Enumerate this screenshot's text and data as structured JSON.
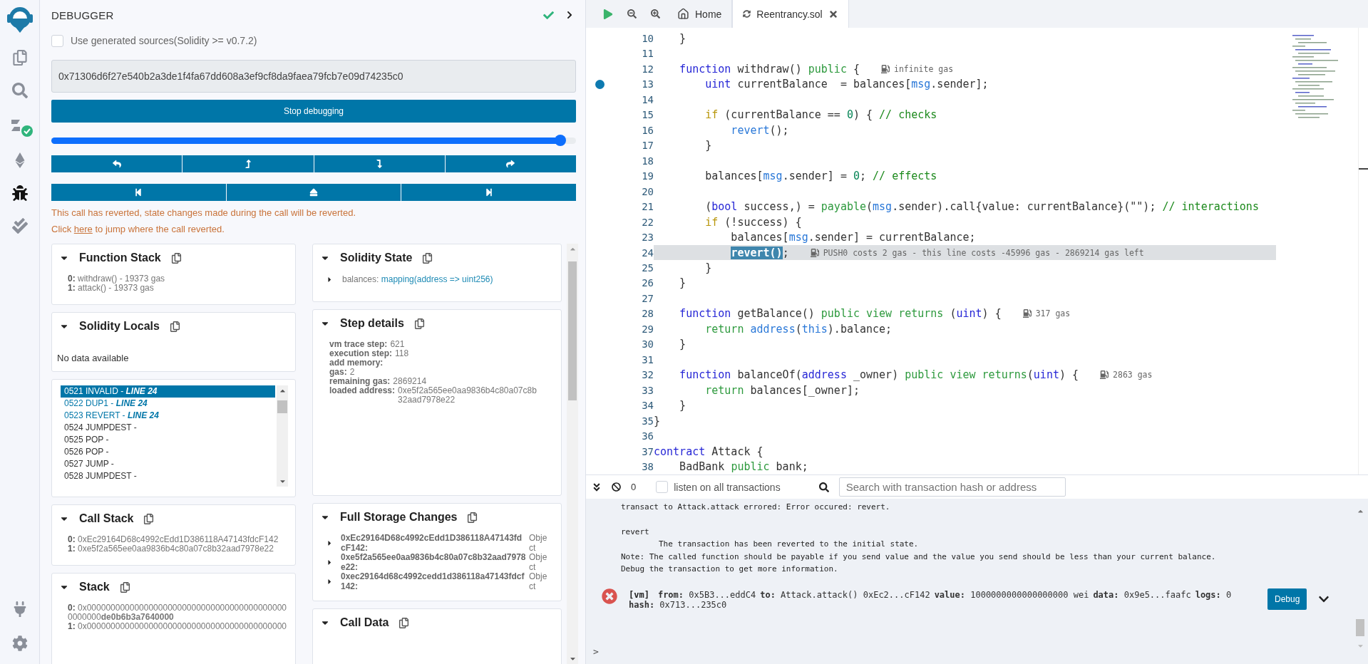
{
  "sidebar": {
    "items": [
      {
        "kind": "files",
        "selected": false
      },
      {
        "kind": "search",
        "selected": false
      },
      {
        "kind": "compiler",
        "selected": false
      },
      {
        "kind": "deploy",
        "selected": false
      },
      {
        "kind": "debugger",
        "selected": true
      },
      {
        "kind": "tests",
        "selected": false
      }
    ],
    "bottom": [
      {
        "kind": "plugins",
        "selected": false
      },
      {
        "kind": "settings",
        "selected": false
      }
    ]
  },
  "debugger": {
    "title": "DEBUGGER",
    "generated_sources": {
      "label": "Use generated sources(Solidity >= v0.7.2)",
      "checked": false
    },
    "tx_hash": "0x71306d6f27e540b2a3de1f4fa67dd608a3ef9cf8da9faea79fcb7e09d74235c0",
    "stop_button": "Stop debugging",
    "slider": {
      "level": 0.97
    },
    "error": {
      "message": "This call has reverted, state changes made during the call will be reverted.",
      "before": "Click",
      "link": "here",
      "after": "to jump where the call reverted."
    },
    "left_panels": [
      {
        "kind": "list",
        "title": "Function Stack",
        "expanded": true,
        "items": [
          {
            "index": "0:",
            "value": "withdraw() - 19373 gas"
          },
          {
            "index": "1:",
            "value": "attack() - 19373 gas"
          }
        ]
      },
      {
        "kind": "empty",
        "title": "Solidity Locals",
        "expanded": true,
        "message": "No data available"
      },
      {
        "kind": "opcodes",
        "items": [
          {
            "code": "0521 INVALID -",
            "line": "LINE 24",
            "selected": true
          },
          {
            "code": "0522 DUP1 -",
            "line": "LINE 24",
            "selected": false
          },
          {
            "code": "0523 REVERT -",
            "line": "LINE 24",
            "selected": false
          },
          {
            "code": "0524 JUMPDEST -",
            "selected": false
          },
          {
            "code": "0525 POP -",
            "selected": false
          },
          {
            "code": "0526 POP -",
            "selected": false
          },
          {
            "code": "0527 JUMP -",
            "selected": false
          },
          {
            "code": "0528 JUMPDEST -",
            "selected": false
          }
        ]
      },
      {
        "kind": "list",
        "title": "Call Stack",
        "expanded": true,
        "items": [
          {
            "index": "0:",
            "value": "0xEc29164D68c4992cEdd1D386118A47143fdcF142"
          },
          {
            "index": "1:",
            "value": "0xe5f2a565ee0aa9836b4c80a07c8b32aad7978e22"
          }
        ]
      },
      {
        "kind": "words",
        "title": "Stack",
        "expanded": true,
        "items": [
          {
            "index": "0:",
            "value": "0x0000000000000000000000000000000000000000000000000**de0b6b3a7640000**"
          },
          {
            "index": "1:",
            "value": "0x000000000000000000000000000000000000000000"
          }
        ]
      }
    ],
    "right_panels": [
      {
        "kind": "tree",
        "title": "Solidity State",
        "expanded": true,
        "items": [
          {
            "name": "balances:",
            "value": "mapping(address => uint256)",
            "expanded": false
          }
        ]
      },
      {
        "kind": "details",
        "title": "Step details",
        "expanded": true,
        "items": [
          {
            "label": "vm trace step:",
            "value": "621"
          },
          {
            "label": "execution step:",
            "value": "118"
          },
          {
            "label": "add memory:"
          },
          {
            "label": "gas:",
            "value": "2"
          },
          {
            "label": "remaining gas:",
            "value": "2869214"
          },
          {
            "label": "loaded address:",
            "value": "0xe5f2a565ee0aa9836b4c80a07c8b32aad7978e22"
          }
        ]
      },
      {
        "kind": "storage",
        "title": "Full Storage Changes",
        "expanded": true,
        "items": [
          {
            "name": "0xEc29164D68c4992cEdd1D386118A47143fdcF142:",
            "value": "Object",
            "expanded": false
          },
          {
            "name": "0xe5f2a565ee0aa9836b4c80a07c8b32aad7978e22:",
            "value": "Object",
            "expanded": false
          },
          {
            "name": "0xec29164d68c4992cedd1d386118a47143fdcf142:",
            "value": "Object",
            "expanded": false
          }
        ]
      },
      {
        "kind": "empty",
        "title": "Call Data",
        "expanded": true
      }
    ]
  },
  "editor": {
    "tabs": [
      {
        "kind": "home",
        "label": "Home",
        "selected": false
      },
      {
        "kind": "file",
        "label": "Reentrancy.sol",
        "selected": true
      }
    ],
    "lines": [
      {
        "number": "10",
        "tokens": [
          {
            "text": "    }",
            "kind": "plain"
          }
        ]
      },
      {
        "number": "11"
      },
      {
        "number": "12",
        "tokens": [
          {
            "text": "    function",
            "kind": "kw"
          },
          {
            "text": " withdraw() ",
            "kind": "plain"
          },
          {
            "text": "public",
            "kind": "mod"
          },
          {
            "text": " {",
            "kind": "plain"
          }
        ],
        "gas": "infinite gas"
      },
      {
        "number": "13",
        "breakpoint": true,
        "tokens": [
          {
            "text": "        uint",
            "kind": "kw"
          },
          {
            "text": " currentBalance  = balances[",
            "kind": "plain"
          },
          {
            "text": "msg",
            "kind": "fn"
          },
          {
            "text": ".sender];",
            "kind": "plain"
          }
        ]
      },
      {
        "number": "14"
      },
      {
        "number": "15",
        "tokens": [
          {
            "text": "        if",
            "kind": "ctl"
          },
          {
            "text": " (currentBalance == ",
            "kind": "plain"
          },
          {
            "text": "0",
            "kind": "num"
          },
          {
            "text": ") { ",
            "kind": "plain"
          },
          {
            "text": "// checks",
            "kind": "cmt"
          }
        ]
      },
      {
        "number": "16",
        "tokens": [
          {
            "text": "            revert",
            "kind": "fn"
          },
          {
            "text": "();",
            "kind": "plain"
          }
        ]
      },
      {
        "number": "17",
        "tokens": [
          {
            "text": "        }",
            "kind": "plain"
          }
        ]
      },
      {
        "number": "18"
      },
      {
        "number": "19",
        "tokens": [
          {
            "text": "        balances[",
            "kind": "plain"
          },
          {
            "text": "msg",
            "kind": "fn"
          },
          {
            "text": ".sender] = ",
            "kind": "plain"
          },
          {
            "text": "0",
            "kind": "num"
          },
          {
            "text": "; ",
            "kind": "plain"
          },
          {
            "text": "// effects",
            "kind": "cmt"
          }
        ]
      },
      {
        "number": "20"
      },
      {
        "number": "21",
        "tokens": [
          {
            "text": "        (",
            "kind": "plain"
          },
          {
            "text": "bool",
            "kind": "kw"
          },
          {
            "text": " success,) = ",
            "kind": "plain"
          },
          {
            "text": "payable",
            "kind": "mod"
          },
          {
            "text": "(",
            "kind": "plain"
          },
          {
            "text": "msg",
            "kind": "fn"
          },
          {
            "text": ".sender).call{value: currentBalance}(\"\"); ",
            "kind": "plain"
          },
          {
            "text": "// interactions",
            "kind": "cmt"
          }
        ]
      },
      {
        "number": "22",
        "tokens": [
          {
            "text": "        if",
            "kind": "ctl"
          },
          {
            "text": " (!success) {",
            "kind": "plain"
          }
        ]
      },
      {
        "number": "23",
        "tokens": [
          {
            "text": "            balances[",
            "kind": "plain"
          },
          {
            "text": "msg",
            "kind": "fn"
          },
          {
            "text": ".sender] = currentBalance;",
            "kind": "plain"
          }
        ]
      },
      {
        "number": "24",
        "current": true,
        "tokens": [
          {
            "text": "            revert()",
            "kind": "sel"
          },
          {
            "text": ";",
            "kind": "plain"
          }
        ],
        "gas": "PUSH0 costs 2 gas - this line costs -45996 gas - 2869214 gas left"
      },
      {
        "number": "25",
        "tokens": [
          {
            "text": "        }",
            "kind": "plain"
          }
        ]
      },
      {
        "number": "26",
        "tokens": [
          {
            "text": "    }",
            "kind": "plain"
          }
        ]
      },
      {
        "number": "27"
      },
      {
        "number": "28",
        "tokens": [
          {
            "text": "    function",
            "kind": "kw"
          },
          {
            "text": " getBalance() ",
            "kind": "plain"
          },
          {
            "text": "public view returns",
            "kind": "mod"
          },
          {
            "text": " (",
            "kind": "plain"
          },
          {
            "text": "uint",
            "kind": "kw"
          },
          {
            "text": ") {",
            "kind": "plain"
          }
        ],
        "gas": "317 gas"
      },
      {
        "number": "29",
        "tokens": [
          {
            "text": "        return",
            "kind": "mod"
          },
          {
            "text": " address",
            "kind": "fn"
          },
          {
            "text": "(",
            "kind": "plain"
          },
          {
            "text": "this",
            "kind": "fn"
          },
          {
            "text": ").balance;",
            "kind": "plain"
          }
        ]
      },
      {
        "number": "30",
        "tokens": [
          {
            "text": "    }",
            "kind": "plain"
          }
        ]
      },
      {
        "number": "31"
      },
      {
        "number": "32",
        "tokens": [
          {
            "text": "    function",
            "kind": "kw"
          },
          {
            "text": " balanceOf(",
            "kind": "plain"
          },
          {
            "text": "address",
            "kind": "kw"
          },
          {
            "text": " _owner) ",
            "kind": "plain"
          },
          {
            "text": "public view returns",
            "kind": "mod"
          },
          {
            "text": "(",
            "kind": "plain"
          },
          {
            "text": "uint",
            "kind": "kw"
          },
          {
            "text": ") {",
            "kind": "plain"
          }
        ],
        "gas": "2863 gas"
      },
      {
        "number": "33",
        "tokens": [
          {
            "text": "        return",
            "kind": "mod"
          },
          {
            "text": " balances[_owner];",
            "kind": "plain"
          }
        ]
      },
      {
        "number": "34",
        "tokens": [
          {
            "text": "    }",
            "kind": "plain"
          }
        ]
      },
      {
        "number": "35",
        "tokens": [
          {
            "text": "}",
            "kind": "plain"
          }
        ]
      },
      {
        "number": "36"
      },
      {
        "number": "37",
        "tokens": [
          {
            "text": "contract",
            "kind": "kw"
          },
          {
            "text": " Attack {",
            "kind": "plain"
          }
        ]
      },
      {
        "number": "38",
        "tokens": [
          {
            "text": "    BadBank ",
            "kind": "plain"
          },
          {
            "text": "public",
            "kind": "mod"
          },
          {
            "text": " bank;",
            "kind": "plain"
          }
        ]
      }
    ]
  },
  "terminal": {
    "count": "0",
    "listen": {
      "label": "listen on all transactions",
      "checked": false
    },
    "search": {
      "placeholder": "Search with transaction hash or address"
    },
    "log_blocks": [
      [
        {
          "kind": "head",
          "text": "transact to Attack.attack errored: Error occured: revert."
        }
      ],
      [
        {
          "kind": "head",
          "text": "revert"
        },
        {
          "kind": "detail",
          "text": "The transaction has been reverted to the initial state."
        },
        {
          "kind": "head",
          "text": "Note: The called function should be payable if you send value and the value you send should be less than your current balance."
        },
        {
          "kind": "head",
          "text": "Debug the transaction to get more information."
        }
      ]
    ],
    "transaction": {
      "failed": true,
      "tag": "[vm]",
      "fields": [
        {
          "label": "from:",
          "value": "0x5B3...eddC4"
        },
        {
          "label": "to:",
          "value": "Attack.attack() 0xEc2...cF142"
        },
        {
          "label": "value:",
          "value": "1000000000000000000 wei"
        },
        {
          "label": "data:",
          "value": "0x9e5...faafc"
        },
        {
          "label": "logs:",
          "value": "0"
        },
        {
          "label": "hash:",
          "value": "0x713...235c0"
        }
      ],
      "button": "Debug"
    },
    "prompt": ">"
  }
}
